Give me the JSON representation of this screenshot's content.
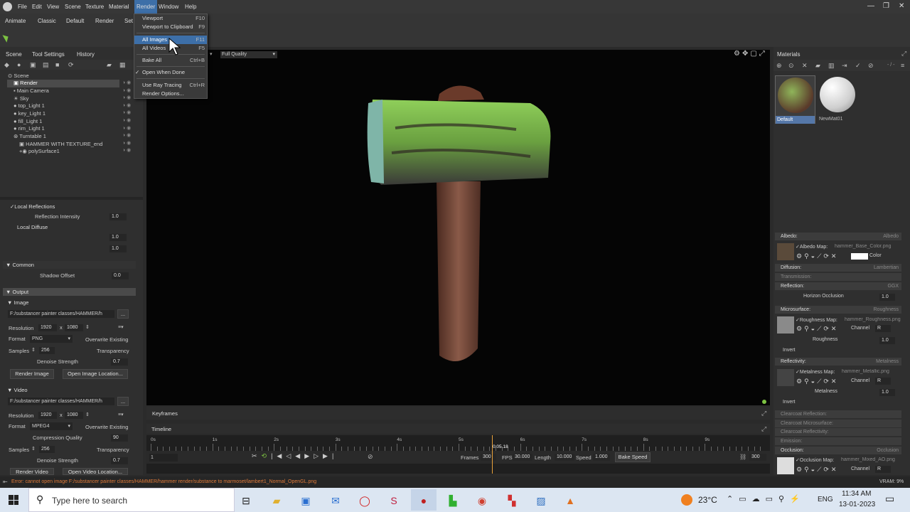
{
  "menubar": {
    "items": [
      "File",
      "Edit",
      "View",
      "Scene",
      "Texture",
      "Material",
      "Render",
      "Window",
      "Help"
    ],
    "window_controls": [
      "—",
      "❐",
      "✕"
    ]
  },
  "toolbar": {
    "tabs": [
      "Animate",
      "Classic",
      "Default",
      "Render",
      "Set"
    ]
  },
  "render_menu": {
    "items": [
      {
        "label": "Viewport",
        "shortcut": "F10"
      },
      {
        "label": "Viewport to Clipboard",
        "shortcut": "F9"
      },
      {
        "label": "All Images",
        "shortcut": "F11"
      },
      {
        "label": "All Videos",
        "shortcut": "F5"
      },
      {
        "label": "Bake All",
        "shortcut": "Ctrl+B"
      },
      {
        "label": "Open When Done",
        "shortcut": "",
        "check": "✓"
      },
      {
        "label": "Use Ray Tracing",
        "shortcut": "Ctrl+R"
      },
      {
        "label": "Render Options...",
        "shortcut": ""
      }
    ]
  },
  "left_panel": {
    "tabs": [
      "Scene",
      "Tool Settings",
      "History"
    ],
    "tree": [
      {
        "label": "Scene",
        "indent": 0
      },
      {
        "label": "Render",
        "indent": 1
      },
      {
        "label": "Main Camera",
        "indent": 1
      },
      {
        "label": "Sky",
        "indent": 1
      },
      {
        "label": "top_Light 1",
        "indent": 1
      },
      {
        "label": "key_Light 1",
        "indent": 1
      },
      {
        "label": "fill_Light 1",
        "indent": 1
      },
      {
        "label": "rim_Light 1",
        "indent": 1
      },
      {
        "label": "Turntable 1",
        "indent": 1
      },
      {
        "label": "HAMMER WITH TEXTURE_end",
        "indent": 2
      },
      {
        "label": "polySurface1",
        "indent": 3
      }
    ],
    "local_reflections": "Local Reflections",
    "reflection_intensity_label": "Reflection Intensity",
    "reflection_intensity": "1.0",
    "local_diffuse": "Local Diffuse",
    "local_diffuse_v1": "1.0",
    "local_diffuse_v2": "1.0",
    "common": "Common",
    "shadow_offset_label": "Shadow Offset",
    "shadow_offset": "0.0",
    "output": "Output",
    "image": {
      "header": "Image",
      "path": "F:/substancer painter classes/HAMMER/h",
      "browse": "...",
      "resolution_label": "Resolution",
      "res_w": "1920",
      "x": "x",
      "res_h": "1080",
      "format_label": "Format",
      "format": "PNG",
      "overwrite": "Overwrite Existing",
      "samples_label": "Samples",
      "samples": "256",
      "transparency": "Transparency",
      "denoise_label": "Denoise Strength",
      "denoise": "0.7",
      "render_btn": "Render Image",
      "open_btn": "Open Image Location..."
    },
    "video": {
      "header": "Video",
      "path": "F:/substancer painter classes/HAMMER/h",
      "browse": "...",
      "resolution_label": "Resolution",
      "res_w": "1920",
      "x": "x",
      "res_h": "1080",
      "format_label": "Format",
      "format": "MPEG4",
      "overwrite": "Overwrite Existing",
      "compression_label": "Compression Quality",
      "compression": "90",
      "samples_label": "Samples",
      "samples": "256",
      "transparency": "Transparency",
      "denoise_label": "Denoise Strength",
      "denoise": "0.7",
      "render_btn": "Render Video",
      "open_btn": "Open Video Location..."
    }
  },
  "viewport": {
    "quality": "Full Quality"
  },
  "bottom": {
    "keyframes_tab": "Keyframes",
    "timeline_tab": "Timeline",
    "ticks": [
      "0s",
      "1s",
      "2s",
      "3s",
      "4s",
      "5s",
      "6s",
      "7s",
      "8s",
      "9s"
    ],
    "current_time": "0:05.18",
    "frame_start": "1",
    "frames_label": "Frames",
    "frames": "300",
    "fps_label": "FPS",
    "fps": "30.000",
    "length_label": "Length",
    "length": "10.000",
    "speed_label": "Speed",
    "speed": "1.000",
    "bake_speed": "Bake Speed",
    "frame_end": "300",
    "playhead_fraction": 0.554
  },
  "right_panel": {
    "tab": "Materials",
    "path": "- / -",
    "materials": [
      {
        "name": "Default",
        "selected": true
      },
      {
        "name": "NewMat01",
        "selected": false
      }
    ],
    "albedo": {
      "header": "Albedo:",
      "value": "Albedo",
      "map_label": "Albedo Map:",
      "map_file": "hammer_Base_Color.png",
      "color": "Color"
    },
    "diffusion": {
      "header": "Diffusion:",
      "value": "Lambertian"
    },
    "transmission": {
      "header": "Transmission:"
    },
    "reflection": {
      "header": "Reflection:",
      "value": "GGX",
      "horizon_label": "Horizon Occlusion",
      "horizon": "1.0"
    },
    "microsurface": {
      "header": "Microsurface:",
      "value": "Roughness",
      "map_label": "Roughness Map:",
      "map_file": "hammer_Roughness.png",
      "channel": "Channel",
      "channel_val": "R",
      "roughness_label": "Roughness",
      "roughness": "1.0",
      "invert": "Invert"
    },
    "reflectivity": {
      "header": "Reflectivity:",
      "value": "Metalness",
      "map_label": "Metalness Map:",
      "map_file": "hammer_Metallic.png",
      "channel": "Channel",
      "channel_val": "R",
      "metalness_label": "Metalness",
      "metalness": "1.0",
      "invert": "Invert"
    },
    "clearcoat_reflection": "Clearcoat Reflection:",
    "clearcoat_microsurface": "Clearcoat Microsurface:",
    "clearcoat_reflectivity": "Clearcoat Reflectivity:",
    "emission": "Emission:",
    "occlusion": {
      "header": "Occlusion:",
      "value": "Occlusion",
      "map_label": "Occlusion Map:",
      "map_file": "hammer_Mixed_AO.png",
      "channel": "Channel",
      "channel_val": "R"
    }
  },
  "status": {
    "error": "Error: cannot open image F:/substancer painter classes/HAMMER/hammer render/substance to marmoset/lambert1_Normal_OpenGL.png",
    "vram": "VRAM: 9%"
  },
  "taskbar": {
    "search_placeholder": "Type here to search",
    "temperature": "23°C",
    "language": "ENG",
    "time": "11:34 AM",
    "date": "13-01-2023"
  },
  "colors": {
    "accent_green": "#7cc242",
    "menu_highlight": "#3d6fa8",
    "error_text": "#e07a3a"
  }
}
